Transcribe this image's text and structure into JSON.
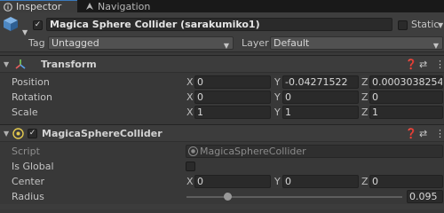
{
  "tabs": [
    {
      "label": "Inspector",
      "icon": "info-icon",
      "active": true
    },
    {
      "label": "Navigation",
      "icon": "navigation-icon",
      "active": false
    }
  ],
  "object": {
    "icon": "gameobject-cube-icon",
    "active": true,
    "name": "Magica Sphere Collider (sarakumiko1)",
    "static_label": "Static",
    "static_checked": false,
    "tag_label": "Tag",
    "tag_value": "Untagged",
    "layer_label": "Layer",
    "layer_value": "Default"
  },
  "transform": {
    "title": "Transform",
    "icon": "transform-axes-icon",
    "position_label": "Position",
    "rotation_label": "Rotation",
    "scale_label": "Scale",
    "axis_x": "X",
    "axis_y": "Y",
    "axis_z": "Z",
    "position": {
      "x": "0",
      "y": "-0.04271522",
      "z": "0.0003038254"
    },
    "rotation": {
      "x": "0",
      "y": "0",
      "z": "0"
    },
    "scale": {
      "x": "1",
      "y": "1",
      "z": "1"
    }
  },
  "collider": {
    "title": "MagicaSphereCollider",
    "icon": "script-sphere-icon",
    "enabled": true,
    "script_label": "Script",
    "script_value": "MagicaSphereCollider",
    "is_global_label": "Is Global",
    "is_global": false,
    "center_label": "Center",
    "center": {
      "x": "0",
      "y": "0",
      "z": "0"
    },
    "radius_label": "Radius",
    "radius_value": "0.095",
    "radius_slider_fraction": 0.19
  },
  "header_buttons": [
    "help-icon",
    "presets-icon",
    "more-icon"
  ],
  "colors": {
    "accent": "#3a79bb",
    "panel": "#383838",
    "field": "#2a2a2a"
  }
}
